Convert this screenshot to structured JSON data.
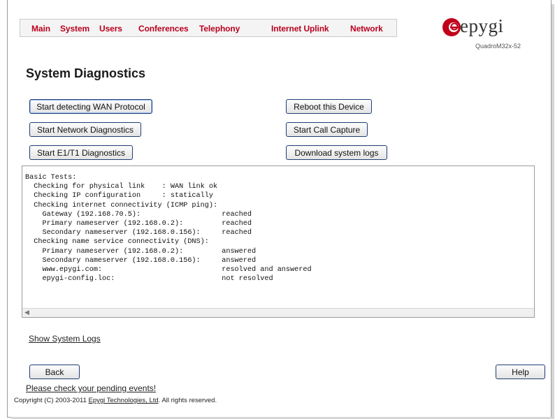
{
  "menu": {
    "items": [
      {
        "label": "Main"
      },
      {
        "label": "System"
      },
      {
        "label": "Users"
      },
      {
        "label": "Conferences"
      },
      {
        "label": "Telephony"
      },
      {
        "label": "Internet Uplink"
      },
      {
        "label": "Network"
      }
    ]
  },
  "brand": {
    "logo_text": "epygi",
    "model": "QuadroM32x-52",
    "logo_color": "#c0001a"
  },
  "page": {
    "title": "System Diagnostics"
  },
  "buttons": {
    "detect_wan": "Start detecting WAN Protocol",
    "network_diag": "Start Network Diagnostics",
    "e1t1_diag": "Start E1/T1 Diagnostics",
    "reboot": "Reboot this Device",
    "call_capture": "Start Call Capture",
    "download_logs": "Download system logs",
    "back": "Back",
    "help": "Help"
  },
  "console": {
    "lines": [
      "Basic Tests:",
      "  Checking for physical link    : WAN link ok",
      "  Checking IP configuration     : statically",
      "  Checking internet connectivity (ICMP ping):",
      "    Gateway (192.168.70.5):                   reached",
      "    Primary nameserver (192.168.0.2):         reached",
      "    Secondary nameserver (192.168.0.156):     reached",
      "  Checking name service connectivity (DNS):",
      "    Primary nameserver (192.168.0.2):         answered",
      "    Secondary nameserver (192.168.0.156):     answered",
      "    www.epygi.com:                            resolved and answered",
      "    epygi-config.loc:                         not resolved"
    ]
  },
  "links": {
    "show_logs": "Show System Logs",
    "pending_events": "Please check your pending events!"
  },
  "footer": {
    "copyright_prefix": "Copyright (C) 2003-2011 ",
    "company": "Epygi Technologies, Ltd",
    "copyright_suffix": ". All rights reserved."
  }
}
